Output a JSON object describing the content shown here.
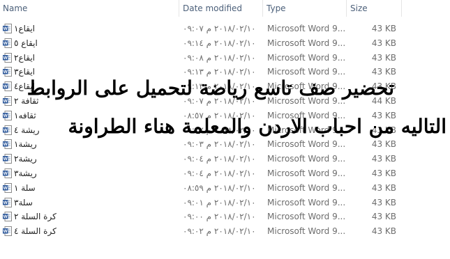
{
  "header": {
    "name": "Name",
    "date_modified": "Date modified",
    "type": "Type",
    "size": "Size"
  },
  "files": [
    {
      "name": "ايقاع١",
      "date": "٢٠١٨/٠٢/١٠ م ٠٩:٠٧",
      "type": "Microsoft Word 9...",
      "size": "43 KB"
    },
    {
      "name": "ايقاع ٥",
      "date": "٢٠١٨/٠٢/١٠ م ٠٩:١٤",
      "type": "Microsoft Word 9...",
      "size": "43 KB"
    },
    {
      "name": "ايقاع٢",
      "date": "٢٠١٨/٠٢/١٠ م ٠٩:٠٨",
      "type": "Microsoft Word 9...",
      "size": "43 KB"
    },
    {
      "name": "ايقاع٣",
      "date": "٢٠١٨/٠٢/١٠ م ٠٩:١٣",
      "type": "Microsoft Word 9...",
      "size": "43 KB"
    },
    {
      "name": "ايقاع٤",
      "date": "٢٠١٨/٠٢/١٠ م ٠٩:١٣",
      "type": "Microsoft Word 9...",
      "size": "43 KB"
    },
    {
      "name": "ثقافة ٢",
      "date": "٢٠١٨/٠٢/١٠ م ٠٩:٠٧",
      "type": "Microsoft Word 9...",
      "size": "44 KB"
    },
    {
      "name": "ثقافه١",
      "date": "٢٠١٨/٠٢/١٠ م ٠٨:٥٧",
      "type": "Microsoft Word 9...",
      "size": "43 KB"
    },
    {
      "name": "ريشة ٤",
      "date": "٢٠١٨/٠٢/١٠ م ٠٩:٠٢",
      "type": "Microsoft Word 9...",
      "size": "43 KB"
    },
    {
      "name": "ريشة١",
      "date": "٢٠١٨/٠٢/١٠ م ٠٩:٠٣",
      "type": "Microsoft Word 9...",
      "size": "43 KB"
    },
    {
      "name": "ريشة٢",
      "date": "٢٠١٨/٠٢/١٠ م ٠٩:٠٤",
      "type": "Microsoft Word 9...",
      "size": "43 KB"
    },
    {
      "name": "ريشة٣",
      "date": "٢٠١٨/٠٢/١٠ م ٠٩:٠٤",
      "type": "Microsoft Word 9...",
      "size": "43 KB"
    },
    {
      "name": "سلة ١",
      "date": "٢٠١٨/٠٢/١٠ م ٠٨:٥٩",
      "type": "Microsoft Word 9...",
      "size": "43 KB"
    },
    {
      "name": "سلة٣",
      "date": "٢٠١٨/٠٢/١٠ م ٠٩:٠١",
      "type": "Microsoft Word 9...",
      "size": "43 KB"
    },
    {
      "name": "كرة السلة ٢",
      "date": "٢٠١٨/٠٢/١٠ م ٠٩:٠٠",
      "type": "Microsoft Word 9...",
      "size": "43 KB"
    },
    {
      "name": "كرة السلة ٤",
      "date": "٢٠١٨/٠٢/١٠ م ٠٩:٠٢",
      "type": "Microsoft Word 9...",
      "size": "43 KB"
    }
  ],
  "overlay": {
    "line1": "تحضير صف تاسع رياضة لتحميل على الروابط",
    "line2": "التاليه من احباب الاردن والمعلمة هناء الطراونة"
  },
  "colors": {
    "word_icon": "#2b579a",
    "header_text": "#4c607a"
  }
}
